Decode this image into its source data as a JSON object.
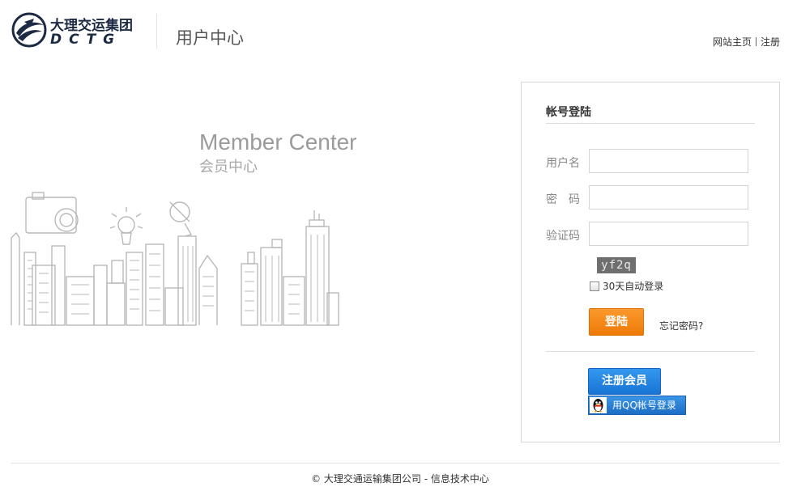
{
  "header": {
    "logo_cn": "大理交运集团",
    "logo_en": "DCTG",
    "title": "用户中心",
    "links": [
      "网站主页",
      "注册"
    ]
  },
  "hero": {
    "title_en": "Member Center",
    "title_cn": "会员中心"
  },
  "login": {
    "title": "帐号登陆",
    "fields": [
      {
        "label": "用户名",
        "value": "",
        "placeholder": ""
      },
      {
        "label": "密　码",
        "value": "",
        "placeholder": ""
      },
      {
        "label": "验证码",
        "value": "",
        "placeholder": ""
      }
    ],
    "captcha_text": "yf2q",
    "remember_label": "30天自动登录",
    "remember_checked": false,
    "login_button": "登陆",
    "forgot_link": "忘记密码?",
    "register_button": "注册会员",
    "qq_button": "用QQ帐号登录"
  },
  "footer": {
    "text": "© 大理交通运输集团公司  - 信息技术中心"
  },
  "colors": {
    "login_button": "#f08a14",
    "register_button": "#1f80e0",
    "qq_button": "#2a80d6",
    "brand_dark": "#1c2a44"
  },
  "icons": [
    "dctg-logo-icon",
    "qq-penguin-icon",
    "checkbox-icon",
    "cityscape-illustration"
  ]
}
